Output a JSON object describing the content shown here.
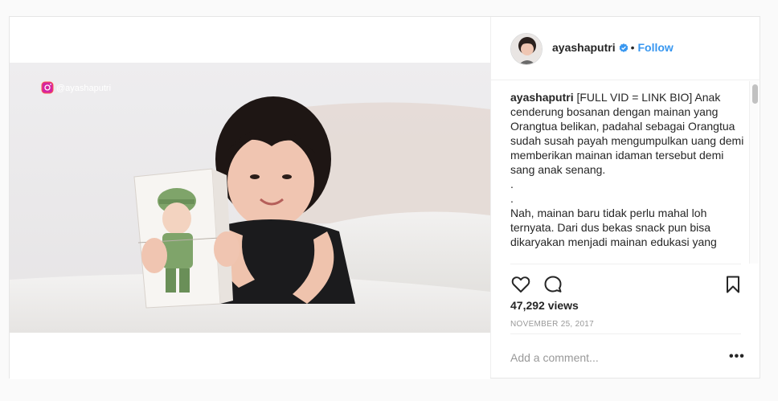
{
  "post": {
    "username": "ayashaputri",
    "separator": "•",
    "follow_label": "Follow",
    "watermark": "@ayashaputri",
    "caption_username": "ayashaputri",
    "caption_text": " [FULL VID = LINK BIO] Anak cenderung bosanan dengan mainan yang Orangtua belikan, padahal sebagai Orangtua sudah susah payah mengumpulkan uang demi memberikan mainan idaman tersebut demi sang anak senang.\n.\n.\nNah, mainan baru tidak perlu mahal loh ternyata. Dari dus bekas snack pun bisa dikaryakan menjadi mainan edukasi yang",
    "views": "47,292 views",
    "date": "NOVEMBER 25, 2017",
    "comment_placeholder": "Add a comment...",
    "more_label": "•••"
  },
  "icons": {
    "verified": "verified-badge-icon",
    "like": "heart-icon",
    "comment": "speech-bubble-icon",
    "save": "bookmark-icon",
    "watermark": "instagram-logo-icon"
  },
  "colors": {
    "accent": "#3897f0",
    "text": "#262626",
    "muted": "#999999",
    "border": "#efefef"
  }
}
